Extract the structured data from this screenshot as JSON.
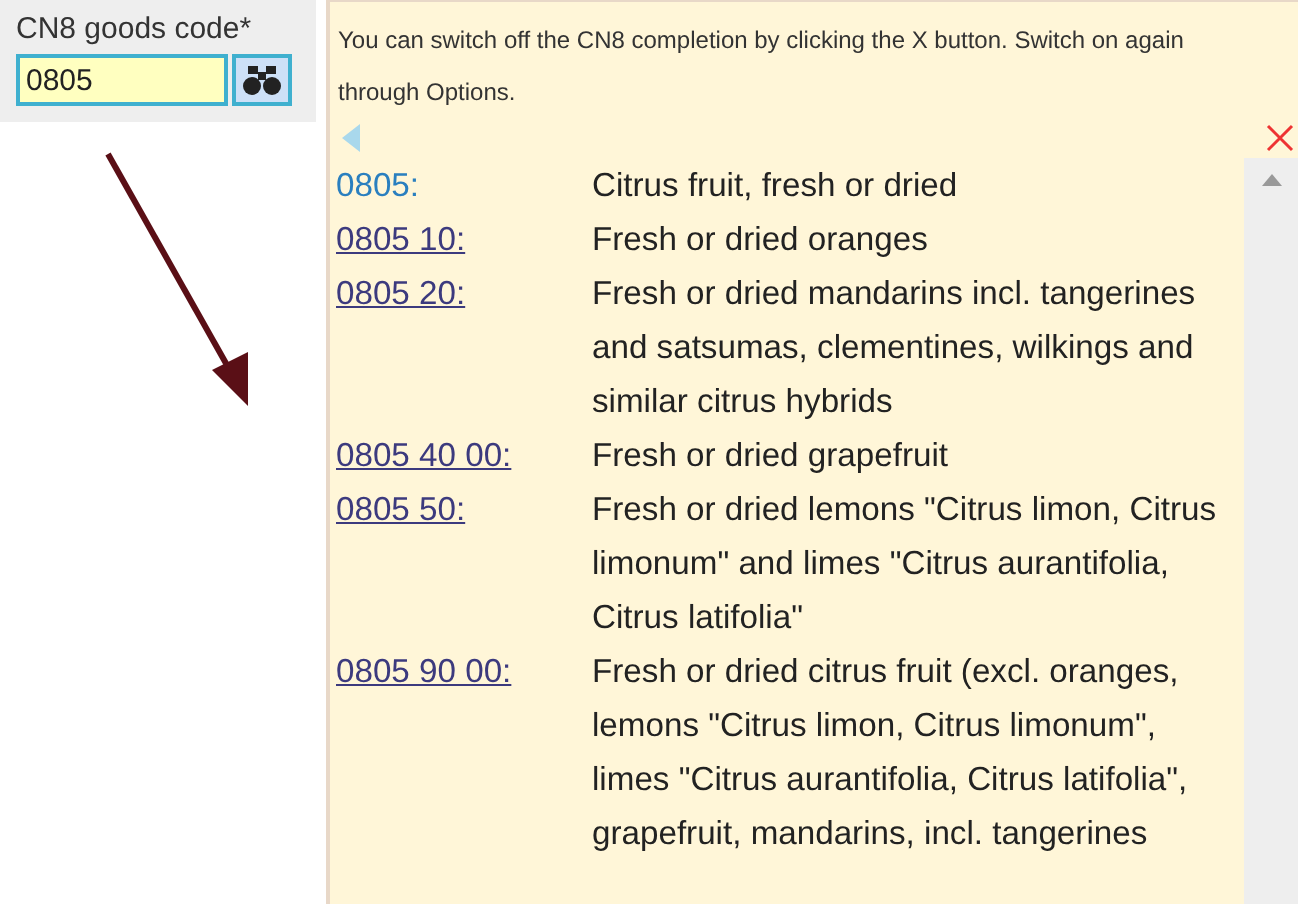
{
  "field": {
    "label": "CN8 goods code*",
    "value": "0805"
  },
  "popup": {
    "hint": "You can switch off the CN8 completion by clicking the X button. Switch on again through Options.",
    "items": [
      {
        "code": "0805:",
        "linked": false,
        "description": "Citrus fruit, fresh or dried"
      },
      {
        "code": "0805 10:",
        "linked": true,
        "description": "Fresh or dried oranges"
      },
      {
        "code": "0805 20:",
        "linked": true,
        "description": "Fresh or dried mandarins incl. tangerines and satsumas, clementines, wilkings and similar citrus hybrids"
      },
      {
        "code": "0805 40 00:",
        "linked": true,
        "description": "Fresh or dried grapefruit"
      },
      {
        "code": "0805 50:",
        "linked": true,
        "description": "Fresh or dried lemons \"Citrus limon, Citrus limonum\" and limes \"Citrus aurantifolia, Citrus latifolia\""
      },
      {
        "code": "0805 90 00:",
        "linked": true,
        "description": "Fresh or dried citrus fruit (excl. oranges, lemons \"Citrus limon, Citrus limonum\", limes \"Citrus aurantifolia, Citrus latifolia\", grapefruit, mandarins, incl. tangerines"
      }
    ]
  }
}
